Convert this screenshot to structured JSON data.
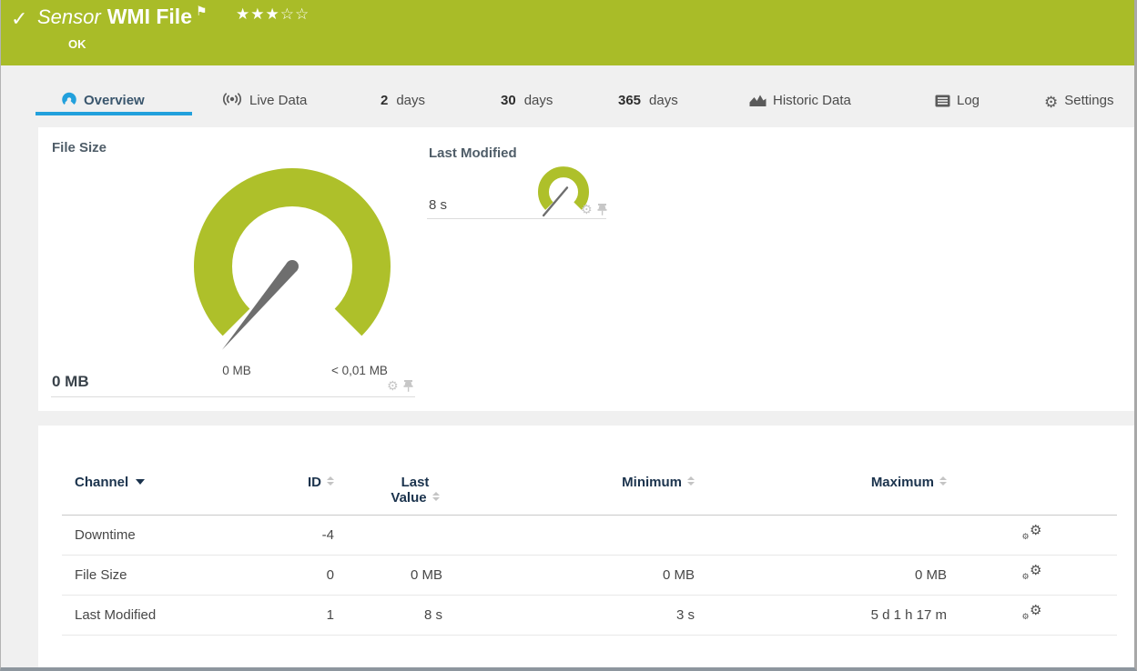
{
  "colors": {
    "brand_green": "#a9bc28",
    "gauge_green": "#aec02a",
    "accent_blue": "#22a0dc",
    "header_navy": "#1b334d"
  },
  "titlebar": {
    "kind": "Sensor",
    "name": "WMI File",
    "status": "OK",
    "rating": "★★★☆☆",
    "stars_filled": 3,
    "stars_total": 5
  },
  "tabs": {
    "overview": {
      "label": "Overview"
    },
    "live": {
      "label": "Live Data"
    },
    "d2": {
      "strong": "2",
      "label": "days"
    },
    "d30": {
      "strong": "30",
      "label": "days"
    },
    "d365": {
      "strong": "365",
      "label": "days"
    },
    "historic": {
      "label": "Historic Data"
    },
    "log": {
      "label": "Log"
    },
    "settings": {
      "label": "Settings"
    }
  },
  "gauges": {
    "file_size": {
      "title": "File Size",
      "value": "0 MB",
      "min_label": "0 MB",
      "max_label": "< 0,01 MB"
    },
    "last_modified": {
      "title": "Last Modified",
      "value": "8 s"
    }
  },
  "channel_table": {
    "headers": {
      "channel": "Channel",
      "id": "ID",
      "last_value": "Last Value",
      "minimum": "Minimum",
      "maximum": "Maximum"
    },
    "rows": [
      {
        "channel": "Downtime",
        "id": "-4",
        "last_value": "",
        "minimum": "",
        "maximum": ""
      },
      {
        "channel": "File Size",
        "id": "0",
        "last_value": "0 MB",
        "minimum": "0 MB",
        "maximum": "0 MB"
      },
      {
        "channel": "Last Modified",
        "id": "1",
        "last_value": "8 s",
        "minimum": "3 s",
        "maximum": "5 d 1 h 17 m"
      }
    ]
  }
}
